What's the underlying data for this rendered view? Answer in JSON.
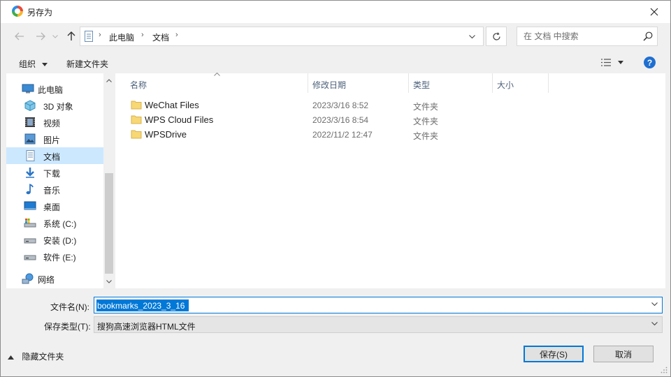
{
  "window": {
    "title": "另存为"
  },
  "address": {
    "path": [
      "此电脑",
      "文档"
    ]
  },
  "search": {
    "placeholder": "在 文档 中搜索"
  },
  "toolbar": {
    "organize": "组织",
    "new_folder": "新建文件夹"
  },
  "sidebar": {
    "items": [
      {
        "label": "此电脑",
        "icon": "computer-icon"
      },
      {
        "label": "3D 对象",
        "icon": "cube-3d-icon"
      },
      {
        "label": "视频",
        "icon": "video-icon"
      },
      {
        "label": "图片",
        "icon": "picture-icon"
      },
      {
        "label": "文档",
        "icon": "document-icon",
        "selected": true
      },
      {
        "label": "下载",
        "icon": "download-icon"
      },
      {
        "label": "音乐",
        "icon": "music-icon"
      },
      {
        "label": "桌面",
        "icon": "desktop-icon"
      },
      {
        "label": "系统 (C:)",
        "icon": "system-drive-icon"
      },
      {
        "label": "安装 (D:)",
        "icon": "drive-icon"
      },
      {
        "label": "软件 (E:)",
        "icon": "drive-icon"
      },
      {
        "label": "网络",
        "icon": "network-icon"
      }
    ]
  },
  "columns": {
    "name": "名称",
    "modified": "修改日期",
    "type": "类型",
    "size": "大小"
  },
  "files": [
    {
      "name": "WeChat Files",
      "modified": "2023/3/16 8:52",
      "type": "文件夹",
      "size": ""
    },
    {
      "name": "WPS Cloud Files",
      "modified": "2023/3/16 8:54",
      "type": "文件夹",
      "size": ""
    },
    {
      "name": "WPSDrive",
      "modified": "2022/11/2 12:47",
      "type": "文件夹",
      "size": ""
    }
  ],
  "form": {
    "filename_label": "文件名(N):",
    "filename_value": "bookmarks_2023_3_16",
    "filetype_label": "保存类型(T):",
    "filetype_value": "搜狗高速浏览器HTML文件"
  },
  "footer": {
    "hide_folders": "隐藏文件夹",
    "save": "保存(S)",
    "cancel": "取消"
  },
  "colors": {
    "accent": "#0078d7",
    "selected": "#cce8ff",
    "folder": "#f8d775",
    "header_text": "#4c607a"
  }
}
